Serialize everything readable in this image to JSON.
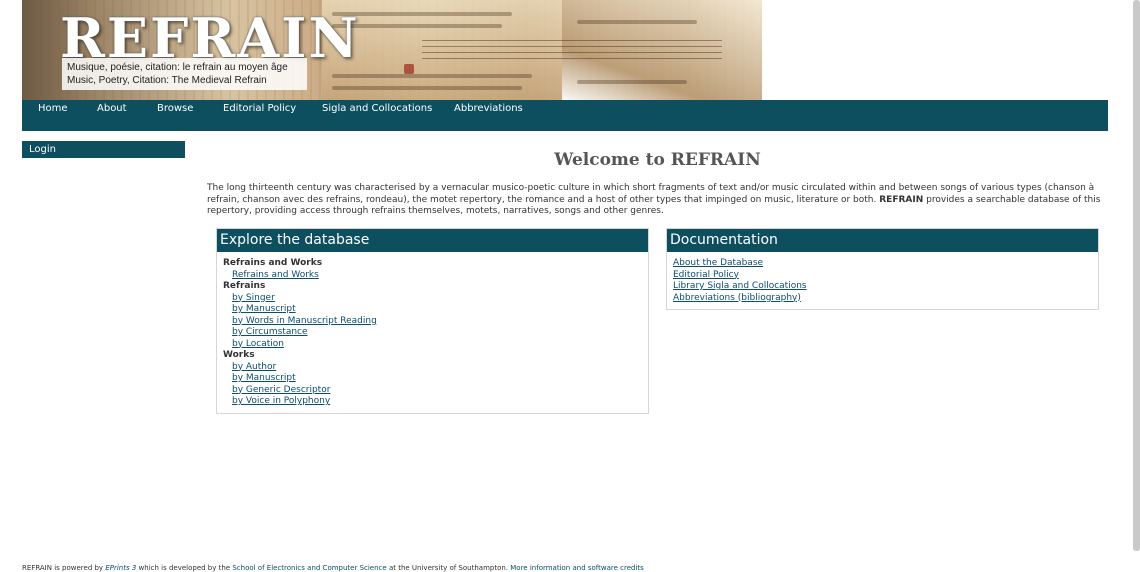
{
  "banner": {
    "logo_text": "REFRAIN",
    "tagline_line1": "Musique, poésie, citation: le refrain au moyen âge",
    "tagline_line2": "Music, Poetry, Citation: The Medieval Refrain"
  },
  "nav": {
    "items": [
      "Home",
      "About",
      "Browse",
      "Editorial Policy",
      "Sigla and Collocations",
      "Abbreviations"
    ]
  },
  "sidebar": {
    "login_label": "Login"
  },
  "main": {
    "title": "Welcome to REFRAIN",
    "intro_text": "The long thirteenth century was characterised by a vernacular musico-poetic culture in which short fragments of text and/or music circulated within and between songs of various types (chanson à refrain, chanson avec des refrains, rondeau), the motet repertory, the romance and a host of other types that impinged on music, literature or both.",
    "intro_bold": "REFRAIN",
    "intro_text2": "provides a searchable database of this repertory, providing access through refrains themselves, motets, narratives, songs and other genres."
  },
  "explore": {
    "title": "Explore the database",
    "section1": "Refrains and Works",
    "section1_links": [
      "Refrains and Works"
    ],
    "section2": "Refrains",
    "section2_links": [
      "by Singer",
      "by Manuscript",
      "by Words in Manuscript Reading",
      "by Circumstance",
      "by Location"
    ],
    "section3": "Works",
    "section3_links": [
      "by Author",
      "by Manuscript",
      "by Generic Descriptor",
      "by Voice in Polyphony"
    ]
  },
  "documentation": {
    "title": "Documentation",
    "links": [
      "About the Database",
      "Editorial Policy",
      "Library Sigla and Collocations",
      "Abbreviations (bibliography)"
    ]
  },
  "footer": {
    "text1": "REFRAIN is powered by",
    "eprints": "EPrints 3",
    "text2": "which is developed by the",
    "school": "School of Electronics and Computer Science",
    "text3": "at the University of Southampton.",
    "more": "More information and software credits"
  },
  "colors": {
    "nav_bg": "#0d4f5f",
    "link": "#0a4d6e"
  }
}
